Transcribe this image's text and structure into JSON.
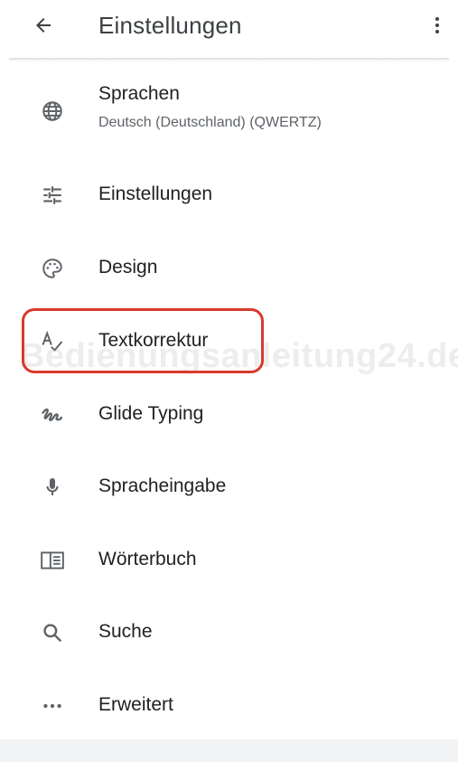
{
  "appbar": {
    "title": "Einstellungen",
    "back_icon": "arrow-back-icon",
    "menu_icon": "more-vert-icon"
  },
  "items": [
    {
      "label": "Sprachen",
      "sub": "Deutsch (Deutschland) (QWERTZ)",
      "icon": "globe-icon"
    },
    {
      "label": "Einstellungen",
      "icon": "tune-icon"
    },
    {
      "label": "Design",
      "icon": "palette-icon"
    },
    {
      "label": "Textkorrektur",
      "icon": "spellcheck-icon"
    },
    {
      "label": "Glide Typing",
      "icon": "gesture-icon"
    },
    {
      "label": "Spracheingabe",
      "icon": "mic-icon"
    },
    {
      "label": "Wörterbuch",
      "icon": "dictionary-icon"
    },
    {
      "label": "Suche",
      "icon": "search-icon"
    },
    {
      "label": "Erweitert",
      "icon": "more-horiz-icon"
    }
  ],
  "watermark": "Bedienungsanleitung24.de",
  "colors": {
    "highlight": "#d93a2b",
    "icon": "#5f6368",
    "text": "#202124"
  }
}
